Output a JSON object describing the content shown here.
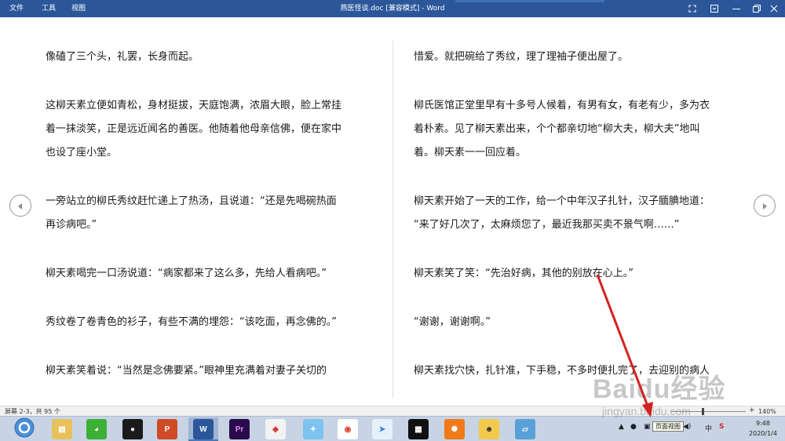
{
  "titlebar": {
    "menus": [
      "文件",
      "工具",
      "视图"
    ],
    "title": "燕医怪谈.doc [兼容模式] - Word"
  },
  "reader": {
    "left_paragraphs": [
      [
        "像磕了三个头，礼罢，长身而起。"
      ],
      [
        "这柳天素立便如青松，身材挺拔，天庭饱满，浓眉大眼，脸上常挂",
        "着一抹淡笑，正是远近闻名的善医。他随着他母亲信佛，便在家中",
        "也设了座小堂。"
      ],
      [
        "一旁站立的柳氏秀纹赶忙递上了热汤，且说道：“还是先喝碗热面",
        "再诊病吧。”"
      ],
      [
        "柳天素喝完一口汤说道：“病家都来了这么多，先给人看病吧。”"
      ],
      [
        "秀纹卷了卷青色的衫子，有些不满的埋怨：“该吃面，再念佛的。”"
      ],
      [
        "柳天素笑着说：“当然是念佛要紧。”眼神里充满着对妻子关切的"
      ]
    ],
    "right_paragraphs": [
      [
        "惜爱。就把碗给了秀纹，理了理袖子便出屋了。"
      ],
      [
        "柳氏医馆正堂里早有十多号人候着，有男有女，有老有少，多为衣",
        "着朴素。见了柳天素出来，个个都亲切地“柳大夫，柳大夫”地叫",
        "着。柳天素一一回应着。"
      ],
      [
        "柳天素开始了一天的工作，给一个中年汉子扎针，汉子腼腆地道：",
        "“来了好几次了，太麻烦您了，最近我那买卖不景气啊……”"
      ],
      [
        "柳天素笑了笑：“先治好病，其他的别放在心上。”"
      ],
      [
        "“谢谢，谢谢啊。”"
      ],
      [
        "柳天素找穴快，扎针准，下手稳，不多时便扎完了，去迎别的病人"
      ]
    ]
  },
  "statusbar": {
    "page_info": "屏幕 2-3，共 95 个",
    "zoom_plus": "+",
    "zoom": "140%",
    "zoom_level_fraction": 0.42
  },
  "taskbar": {
    "apps": [
      "browser",
      "file-explorer",
      "wechat",
      "qq",
      "powerpoint",
      "word",
      "premiere",
      "photo-app",
      "bird-app",
      "chrome",
      "feishu",
      "video-editor",
      "flame-app",
      "avatar-app",
      "notes-app"
    ],
    "tooltip": "页面视图",
    "time": "9:48",
    "date": "2020/1/4",
    "tray_ime": "中"
  },
  "watermark": {
    "text": "Baidu经验",
    "url": "jingyan.baidu.com"
  },
  "colors": {
    "titlebar": "#2b579a",
    "statusbar": "#f1f1f1",
    "taskbar": "#c8d4e4",
    "arrow": "#d42020"
  }
}
